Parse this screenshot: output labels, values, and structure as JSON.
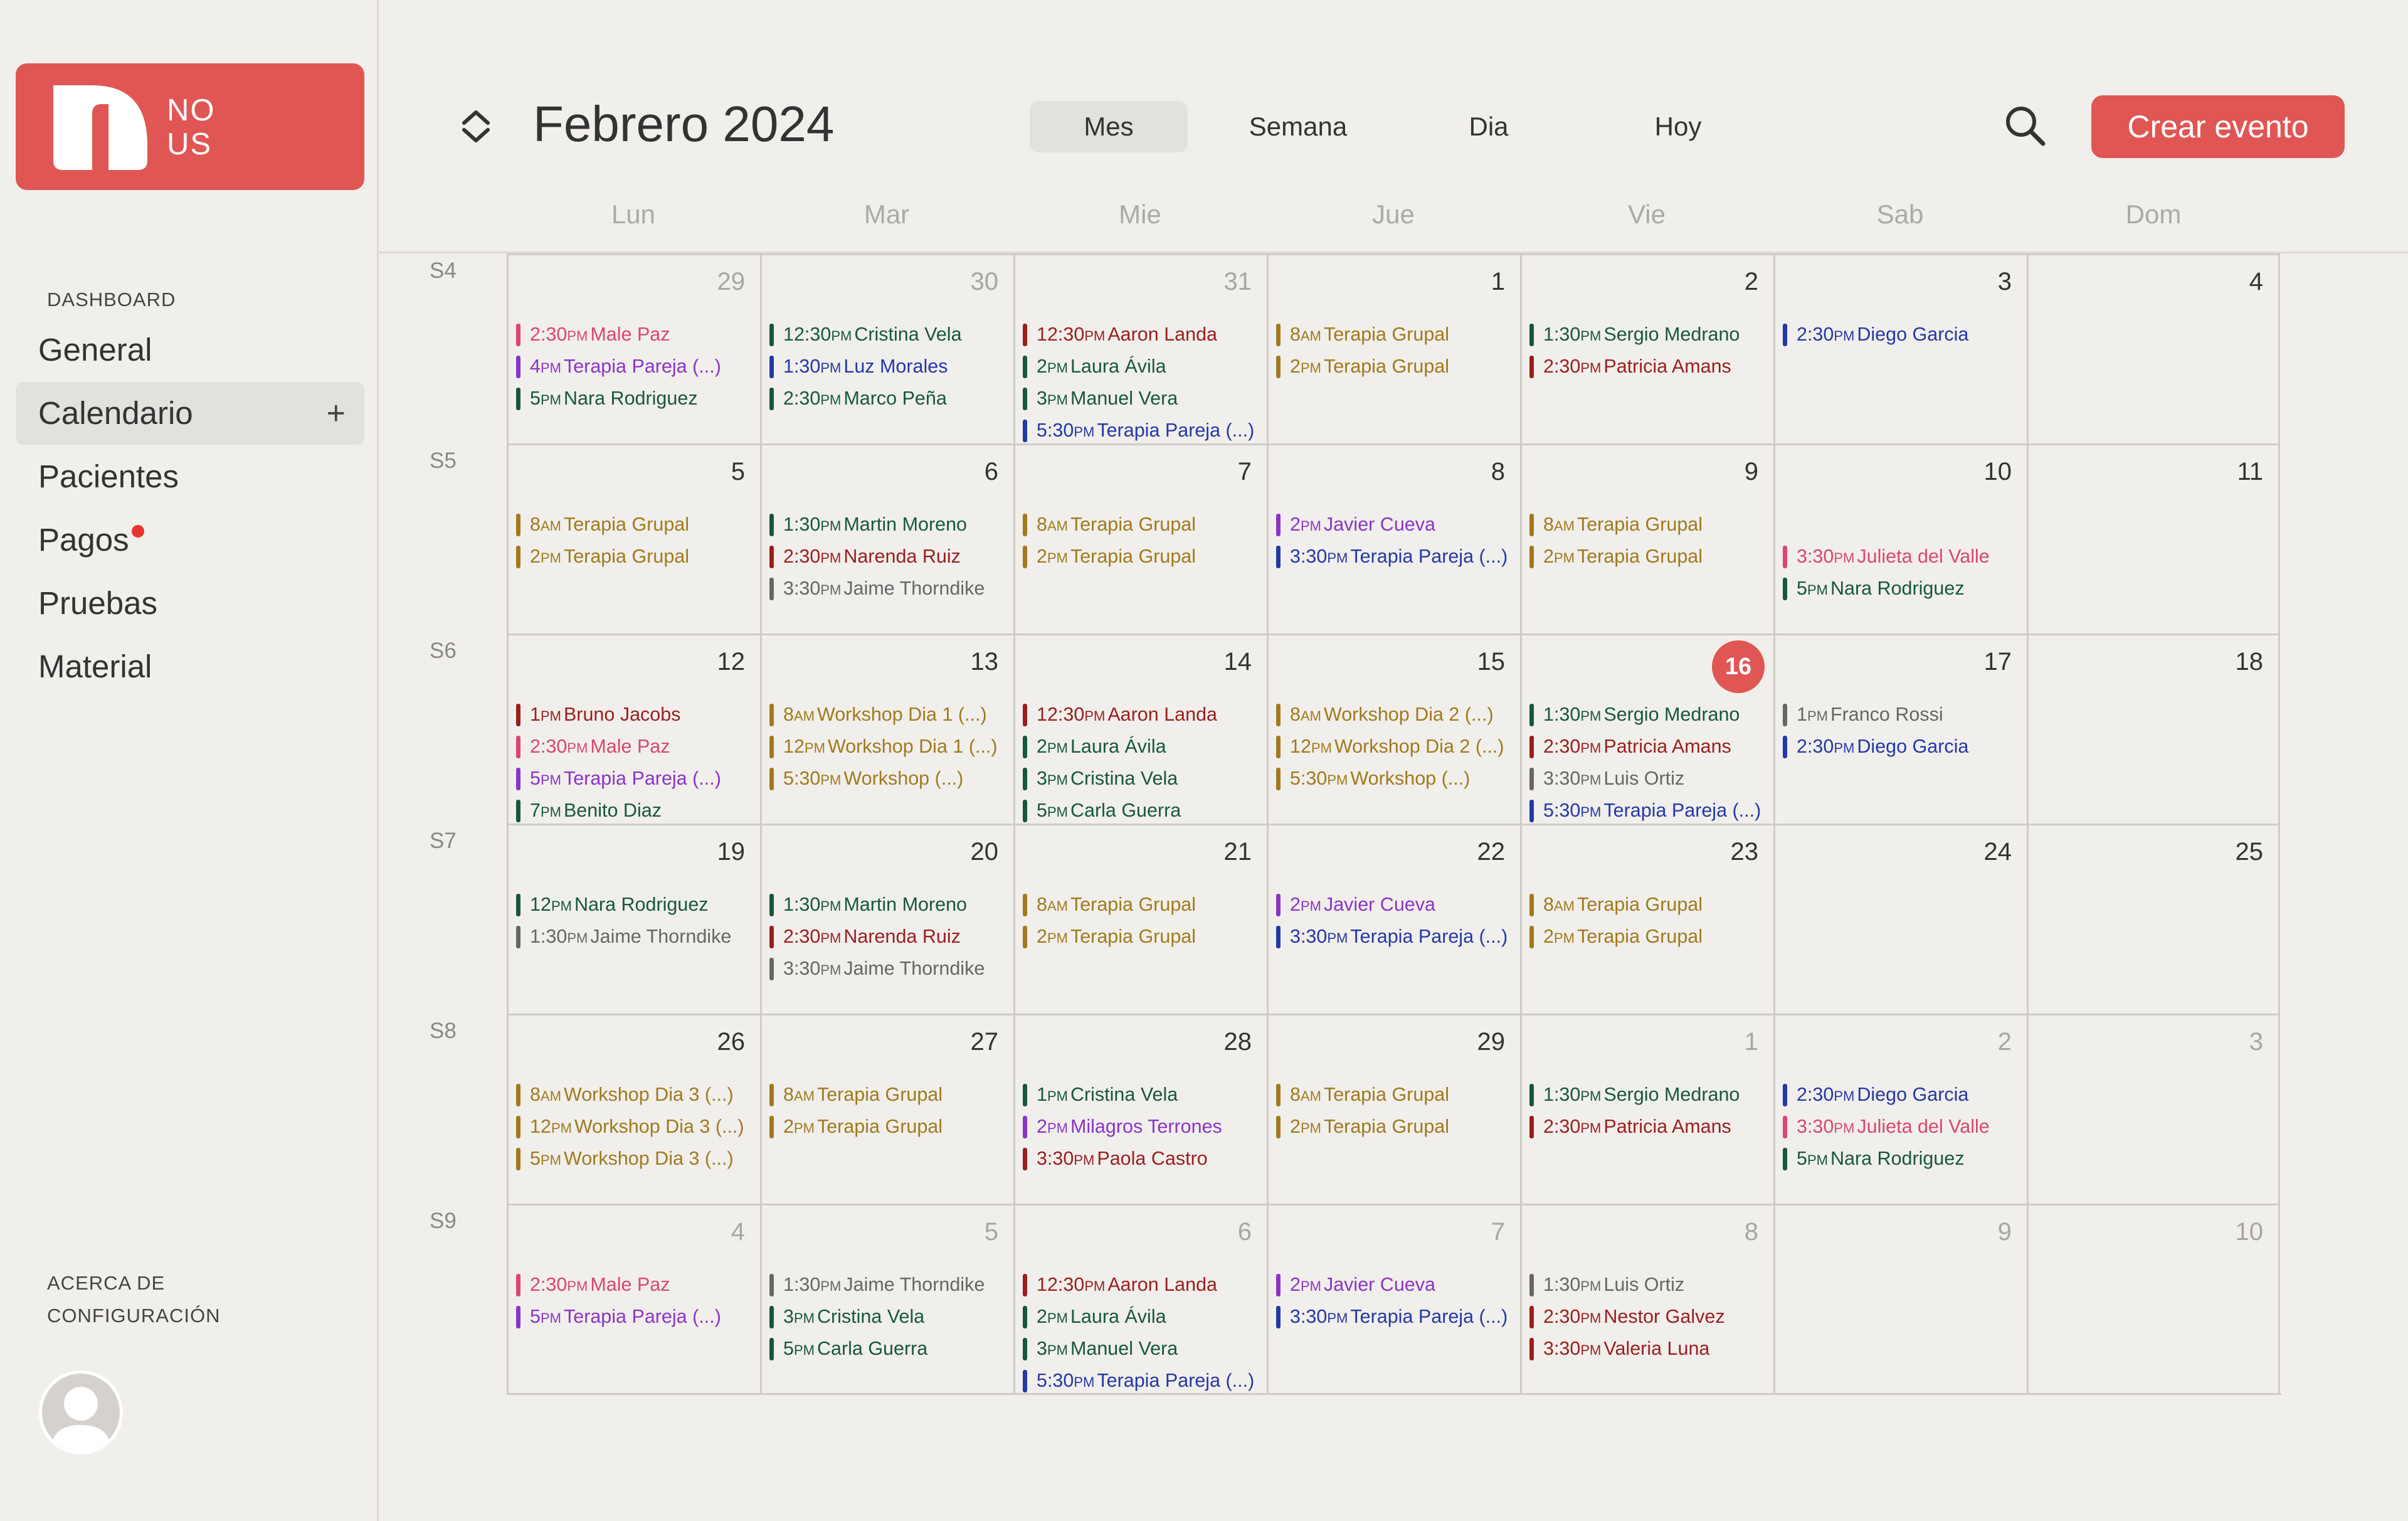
{
  "sidebar": {
    "logo_text": [
      "NO",
      "US"
    ],
    "section_label": "DASHBOARD",
    "items": [
      {
        "label": "General"
      },
      {
        "label": "Calendario",
        "active": true,
        "action": "+"
      },
      {
        "label": "Pacientes"
      },
      {
        "label": "Pagos",
        "notification": true
      },
      {
        "label": "Pruebas"
      },
      {
        "label": "Material"
      }
    ],
    "footer_lines": [
      "ACERCA DE",
      "CONFIGURACIÓN"
    ]
  },
  "header": {
    "title": "Febrero 2024",
    "views": [
      {
        "label": "Mes",
        "active": true
      },
      {
        "label": "Semana"
      },
      {
        "label": "Dia"
      },
      {
        "label": "Hoy"
      }
    ],
    "create_button": "Crear evento"
  },
  "weekdays": [
    "Lun",
    "Mar",
    "Mie",
    "Jue",
    "Vie",
    "Sab",
    "Dom"
  ],
  "colors": {
    "accent": "#e05654",
    "notification": "#e9352c",
    "categories": {
      "pink": "#d9486c",
      "purple": "#8a35c9",
      "green": "#17583c",
      "blue": "#2438a6",
      "red": "#9a1f1f",
      "gold": "#a07a1e",
      "gray": "#666666"
    }
  },
  "weeks": [
    {
      "label": "S4",
      "days": [
        {
          "num": "29",
          "muted": true,
          "events": [
            {
              "time": "2:30",
              "ap": "PM",
              "title": "Male Paz",
              "color": "pink"
            },
            {
              "time": "4",
              "ap": "PM",
              "title": "Terapia Pareja (...)",
              "color": "purple"
            },
            {
              "time": "5",
              "ap": "PM",
              "title": "Nara Rodriguez",
              "color": "green"
            }
          ]
        },
        {
          "num": "30",
          "muted": true,
          "events": [
            {
              "time": "12:30",
              "ap": "PM",
              "title": "Cristina Vela",
              "color": "green"
            },
            {
              "time": "1:30",
              "ap": "PM",
              "title": "Luz Morales",
              "color": "blue"
            },
            {
              "time": "2:30",
              "ap": "PM",
              "title": "Marco Peña",
              "color": "green"
            }
          ]
        },
        {
          "num": "31",
          "muted": true,
          "events": [
            {
              "time": "12:30",
              "ap": "PM",
              "title": "Aaron Landa",
              "color": "red"
            },
            {
              "time": "2",
              "ap": "PM",
              "title": "Laura Ávila",
              "color": "green"
            },
            {
              "time": "3",
              "ap": "PM",
              "title": "Manuel Vera",
              "color": "green"
            },
            {
              "time": "5:30",
              "ap": "PM",
              "title": "Terapia Pareja (...)",
              "color": "blue"
            }
          ]
        },
        {
          "num": "1",
          "events": [
            {
              "time": "8",
              "ap": "AM",
              "title": "Terapia Grupal",
              "color": "gold"
            },
            {
              "time": "2",
              "ap": "PM",
              "title": "Terapia Grupal",
              "color": "gold"
            }
          ]
        },
        {
          "num": "2",
          "events": [
            {
              "time": "1:30",
              "ap": "PM",
              "title": "Sergio Medrano",
              "color": "green"
            },
            {
              "time": "2:30",
              "ap": "PM",
              "title": "Patricia Amans",
              "color": "red"
            }
          ]
        },
        {
          "num": "3",
          "events": [
            {
              "time": "2:30",
              "ap": "PM",
              "title": "Diego Garcia",
              "color": "blue"
            }
          ]
        },
        {
          "num": "4",
          "events": []
        }
      ]
    },
    {
      "label": "S5",
      "days": [
        {
          "num": "5",
          "events": [
            {
              "time": "8",
              "ap": "AM",
              "title": "Terapia Grupal",
              "color": "gold"
            },
            {
              "time": "2",
              "ap": "PM",
              "title": "Terapia Grupal",
              "color": "gold"
            }
          ]
        },
        {
          "num": "6",
          "events": [
            {
              "time": "1:30",
              "ap": "PM",
              "title": "Martin Moreno",
              "color": "green"
            },
            {
              "time": "2:30",
              "ap": "PM",
              "title": "Narenda Ruiz",
              "color": "red"
            },
            {
              "time": "3:30",
              "ap": "PM",
              "title": "Jaime Thorndike",
              "color": "gray"
            }
          ]
        },
        {
          "num": "7",
          "events": [
            {
              "time": "8",
              "ap": "AM",
              "title": "Terapia Grupal",
              "color": "gold"
            },
            {
              "time": "2",
              "ap": "PM",
              "title": "Terapia Grupal",
              "color": "gold"
            }
          ]
        },
        {
          "num": "8",
          "events": [
            {
              "time": "2",
              "ap": "PM",
              "title": "Javier Cueva",
              "color": "purple"
            },
            {
              "time": "3:30",
              "ap": "PM",
              "title": "Terapia Pareja (...)",
              "color": "blue"
            }
          ]
        },
        {
          "num": "9",
          "events": [
            {
              "time": "8",
              "ap": "AM",
              "title": "Terapia Grupal",
              "color": "gold"
            },
            {
              "time": "2",
              "ap": "PM",
              "title": "Terapia Grupal",
              "color": "gold"
            }
          ]
        },
        {
          "num": "10",
          "events": [
            {
              "time": "3:30",
              "ap": "PM",
              "title": "Julieta del Valle",
              "color": "pink",
              "slot": 1
            },
            {
              "time": "5",
              "ap": "PM",
              "title": "Nara Rodriguez",
              "color": "green",
              "slot": 2
            }
          ]
        },
        {
          "num": "11",
          "events": []
        }
      ]
    },
    {
      "label": "S6",
      "days": [
        {
          "num": "12",
          "events": [
            {
              "time": "1",
              "ap": "PM",
              "title": "Bruno Jacobs",
              "color": "red"
            },
            {
              "time": "2:30",
              "ap": "PM",
              "title": "Male Paz",
              "color": "pink"
            },
            {
              "time": "5",
              "ap": "PM",
              "title": "Terapia Pareja (...)",
              "color": "purple"
            },
            {
              "time": "7",
              "ap": "PM",
              "title": "Benito Diaz",
              "color": "green"
            }
          ]
        },
        {
          "num": "13",
          "events": [
            {
              "time": "8",
              "ap": "AM",
              "title": "Workshop Dia 1 (...)",
              "color": "gold"
            },
            {
              "time": "12",
              "ap": "PM",
              "title": "Workshop Dia  1 (...)",
              "color": "gold"
            },
            {
              "time": "5:30",
              "ap": "PM",
              "title": "Workshop (...)",
              "color": "gold"
            }
          ]
        },
        {
          "num": "14",
          "events": [
            {
              "time": "12:30",
              "ap": "PM",
              "title": "Aaron Landa",
              "color": "red"
            },
            {
              "time": "2",
              "ap": "PM",
              "title": "Laura Ávila",
              "color": "green"
            },
            {
              "time": "3",
              "ap": "PM",
              "title": "Cristina Vela",
              "color": "green"
            },
            {
              "time": "5",
              "ap": "PM",
              "title": "Carla Guerra",
              "color": "green"
            }
          ]
        },
        {
          "num": "15",
          "events": [
            {
              "time": "8",
              "ap": "AM",
              "title": "Workshop Dia 2 (...)",
              "color": "gold"
            },
            {
              "time": "12",
              "ap": "PM",
              "title": "Workshop Dia  2 (...)",
              "color": "gold"
            },
            {
              "time": "5:30",
              "ap": "PM",
              "title": "Workshop (...)",
              "color": "gold"
            }
          ]
        },
        {
          "num": "16",
          "today": true,
          "events": [
            {
              "time": "1:30",
              "ap": "PM",
              "title": "Sergio Medrano",
              "color": "green"
            },
            {
              "time": "2:30",
              "ap": "PM",
              "title": "Patricia Amans",
              "color": "red"
            },
            {
              "time": "3:30",
              "ap": "PM",
              "title": "Luis Ortiz",
              "color": "gray"
            },
            {
              "time": "5:30",
              "ap": "PM",
              "title": "Terapia Pareja (...)",
              "color": "blue"
            }
          ]
        },
        {
          "num": "17",
          "events": [
            {
              "time": "1",
              "ap": "PM",
              "title": "Franco Rossi",
              "color": "gray"
            },
            {
              "time": "2:30",
              "ap": "PM",
              "title": "Diego Garcia",
              "color": "blue"
            }
          ]
        },
        {
          "num": "18",
          "events": []
        }
      ]
    },
    {
      "label": "S7",
      "days": [
        {
          "num": "19",
          "events": [
            {
              "time": "12",
              "ap": "PM",
              "title": "Nara Rodriguez",
              "color": "green"
            },
            {
              "time": "1:30",
              "ap": "PM",
              "title": "Jaime Thorndike",
              "color": "gray"
            }
          ]
        },
        {
          "num": "20",
          "events": [
            {
              "time": "1:30",
              "ap": "PM",
              "title": "Martin Moreno",
              "color": "green"
            },
            {
              "time": "2:30",
              "ap": "PM",
              "title": "Narenda Ruiz",
              "color": "red"
            },
            {
              "time": "3:30",
              "ap": "PM",
              "title": "Jaime Thorndike",
              "color": "gray"
            }
          ]
        },
        {
          "num": "21",
          "events": [
            {
              "time": "8",
              "ap": "AM",
              "title": "Terapia Grupal",
              "color": "gold"
            },
            {
              "time": "2",
              "ap": "PM",
              "title": "Terapia Grupal",
              "color": "gold"
            }
          ]
        },
        {
          "num": "22",
          "events": [
            {
              "time": "2",
              "ap": "PM",
              "title": "Javier Cueva",
              "color": "purple"
            },
            {
              "time": "3:30",
              "ap": "PM",
              "title": "Terapia Pareja (...)",
              "color": "blue"
            }
          ]
        },
        {
          "num": "23",
          "events": [
            {
              "time": "8",
              "ap": "AM",
              "title": "Terapia Grupal",
              "color": "gold"
            },
            {
              "time": "2",
              "ap": "PM",
              "title": "Terapia Grupal",
              "color": "gold"
            }
          ]
        },
        {
          "num": "24",
          "events": []
        },
        {
          "num": "25",
          "events": []
        }
      ]
    },
    {
      "label": "S8",
      "days": [
        {
          "num": "26",
          "events": [
            {
              "time": "8",
              "ap": "AM",
              "title": "Workshop Dia 3 (...)",
              "color": "gold"
            },
            {
              "time": "12",
              "ap": "PM",
              "title": "Workshop Dia  3 (...)",
              "color": "gold"
            },
            {
              "time": "5",
              "ap": "PM",
              "title": "Workshop Dia  3 (...)",
              "color": "gold"
            }
          ]
        },
        {
          "num": "27",
          "events": [
            {
              "time": "8",
              "ap": "AM",
              "title": "Terapia Grupal",
              "color": "gold"
            },
            {
              "time": "2",
              "ap": "PM",
              "title": "Terapia Grupal",
              "color": "gold"
            }
          ]
        },
        {
          "num": "28",
          "events": [
            {
              "time": "1",
              "ap": "PM",
              "title": "Cristina Vela",
              "color": "green"
            },
            {
              "time": "2",
              "ap": "PM",
              "title": "Milagros Terrones",
              "color": "purple"
            },
            {
              "time": "3:30",
              "ap": "PM",
              "title": "Paola Castro",
              "color": "red"
            }
          ]
        },
        {
          "num": "29",
          "events": [
            {
              "time": "8",
              "ap": "AM",
              "title": "Terapia Grupal",
              "color": "gold"
            },
            {
              "time": "2",
              "ap": "PM",
              "title": "Terapia Grupal",
              "color": "gold"
            }
          ]
        },
        {
          "num": "1",
          "muted": true,
          "events": [
            {
              "time": "1:30",
              "ap": "PM",
              "title": "Sergio Medrano",
              "color": "green"
            },
            {
              "time": "2:30",
              "ap": "PM",
              "title": "Patricia Amans",
              "color": "red"
            }
          ]
        },
        {
          "num": "2",
          "muted": true,
          "events": [
            {
              "time": "2:30",
              "ap": "PM",
              "title": "Diego Garcia",
              "color": "blue"
            },
            {
              "time": "3:30",
              "ap": "PM",
              "title": "Julieta del Valle",
              "color": "pink"
            },
            {
              "time": "5",
              "ap": "PM",
              "title": "Nara Rodriguez",
              "color": "green"
            }
          ]
        },
        {
          "num": "3",
          "muted": true,
          "events": []
        }
      ]
    },
    {
      "label": "S9",
      "days": [
        {
          "num": "4",
          "muted": true,
          "events": [
            {
              "time": "2:30",
              "ap": "PM",
              "title": "Male Paz",
              "color": "pink"
            },
            {
              "time": "5",
              "ap": "PM",
              "title": "Terapia Pareja (...)",
              "color": "purple"
            }
          ]
        },
        {
          "num": "5",
          "muted": true,
          "events": [
            {
              "time": "1:30",
              "ap": "PM",
              "title": "Jaime Thorndike",
              "color": "gray"
            },
            {
              "time": "3",
              "ap": "PM",
              "title": "Cristina Vela",
              "color": "green"
            },
            {
              "time": "5",
              "ap": "PM",
              "title": "Carla Guerra",
              "color": "green"
            }
          ]
        },
        {
          "num": "6",
          "muted": true,
          "events": [
            {
              "time": "12:30",
              "ap": "PM",
              "title": "Aaron Landa",
              "color": "red"
            },
            {
              "time": "2",
              "ap": "PM",
              "title": "Laura Ávila",
              "color": "green"
            },
            {
              "time": "3",
              "ap": "PM",
              "title": "Manuel Vera",
              "color": "green"
            },
            {
              "time": "5:30",
              "ap": "PM",
              "title": "Terapia Pareja (...)",
              "color": "blue"
            }
          ]
        },
        {
          "num": "7",
          "muted": true,
          "events": [
            {
              "time": "2",
              "ap": "PM",
              "title": "Javier Cueva",
              "color": "purple"
            },
            {
              "time": "3:30",
              "ap": "PM",
              "title": "Terapia Pareja (...)",
              "color": "blue"
            }
          ]
        },
        {
          "num": "8",
          "muted": true,
          "events": [
            {
              "time": "1:30",
              "ap": "PM",
              "title": "Luis Ortiz",
              "color": "gray"
            },
            {
              "time": "2:30",
              "ap": "PM",
              "title": "Nestor Galvez",
              "color": "red"
            },
            {
              "time": "3:30",
              "ap": "PM",
              "title": "Valeria Luna",
              "color": "red"
            }
          ]
        },
        {
          "num": "9",
          "muted": true,
          "events": []
        },
        {
          "num": "10",
          "muted": true,
          "events": []
        }
      ]
    }
  ]
}
